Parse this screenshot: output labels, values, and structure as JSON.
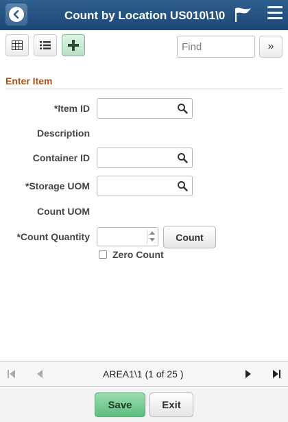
{
  "header": {
    "title": "Count by Location US010\\1\\0"
  },
  "toolbar": {
    "find_placeholder": "Find",
    "more_label": "»"
  },
  "section": {
    "title": "Enter Item"
  },
  "form": {
    "item_id_label": "*Item ID",
    "description_label": "Description",
    "container_id_label": "Container ID",
    "storage_uom_label": "*Storage UOM",
    "count_uom_label": "Count UOM",
    "count_quantity_label": "*Count Quantity",
    "count_button": "Count",
    "zero_count_label": "Zero Count"
  },
  "nav": {
    "record_label": "AREA1\\1 (1 of 25 )"
  },
  "footer": {
    "save_label": "Save",
    "exit_label": "Exit"
  },
  "colors": {
    "header_bg": "#1c4776",
    "section_title": "#a8541a",
    "save_bg": "#5fbd7f"
  }
}
